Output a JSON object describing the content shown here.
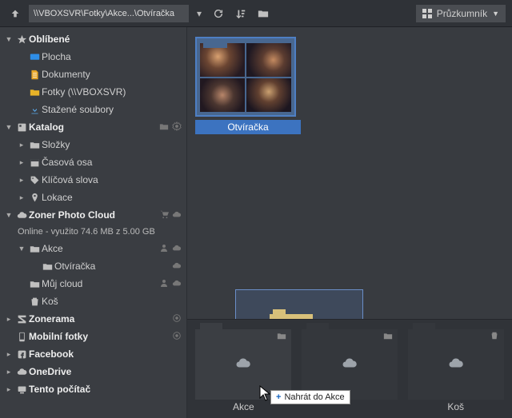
{
  "toolbar": {
    "path": "\\\\VBOXSVR\\Fotky\\Akce...\\Otvíračka",
    "view_label": "Průzkumník"
  },
  "sidebar": {
    "fav_header": "Oblíbené",
    "fav_items": [
      "Plocha",
      "Dokumenty",
      "Fotky (\\\\VBOXSVR)",
      "Stažené soubory"
    ],
    "catalog_header": "Katalog",
    "catalog_items": [
      "Složky",
      "Časová osa",
      "Klíčová slova",
      "Lokace"
    ],
    "cloud_header": "Zoner Photo Cloud",
    "cloud_status": "Online - využito 74.6 MB z 5.00 GB",
    "cloud_items": [
      "Akce",
      "Otvíračka",
      "Můj cloud",
      "Koš"
    ],
    "zonerama": "Zonerama",
    "mobile": "Mobilní fotky",
    "facebook": "Facebook",
    "onedrive": "OneDrive",
    "thispc": "Tento počítač"
  },
  "content": {
    "selected_folder": "Otvíračka"
  },
  "shelf": {
    "items": [
      "Akce",
      "",
      "Koš"
    ]
  },
  "drag": {
    "tooltip": "Nahrát do Akce"
  }
}
